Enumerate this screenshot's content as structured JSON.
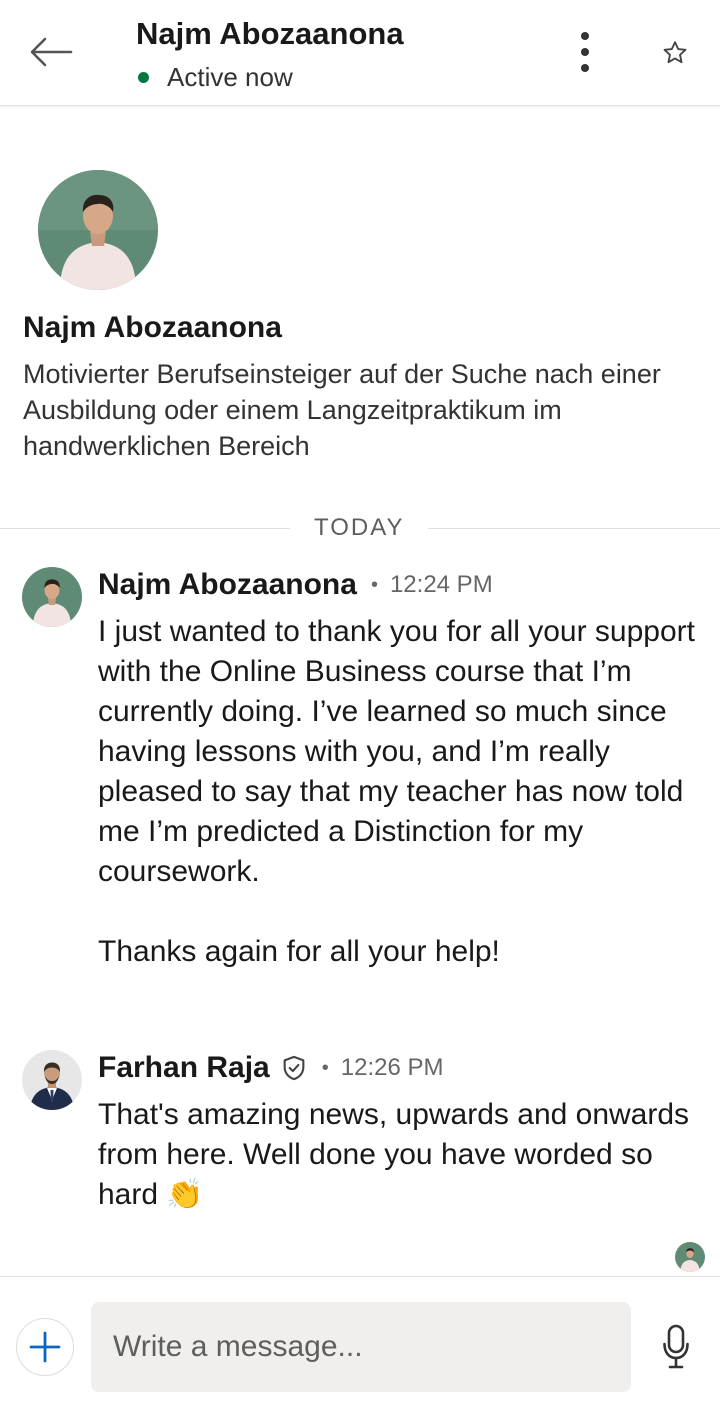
{
  "header": {
    "name": "Najm Abozaanona",
    "status": "Active now",
    "status_color": "#057642"
  },
  "profile": {
    "name": "Najm Abozaanona",
    "headline": "Motivierter Berufseinsteiger auf der Suche nach einer Ausbildung oder einem Langzeitpraktikum im handwerklichen Bereich"
  },
  "divider": {
    "label": "TODAY"
  },
  "messages": [
    {
      "sender": "Najm Abozaanona",
      "time": "12:24 PM",
      "text": "I just wanted to thank you for all your support with the Online Business course that I’m currently doing. I’ve learned so much since having lessons with you, and I’m really pleased to say that my teacher has now told me I’m predicted a Distinction for my coursework.\n\nThanks again for all your help!"
    },
    {
      "sender": "Farhan Raja",
      "time": "12:26 PM",
      "text": "That's amazing news, upwards and onwards from here. Well done you have worded so hard 👏"
    }
  ],
  "composer": {
    "placeholder": "Write a message..."
  },
  "icons": {
    "back": "arrow-left-icon",
    "more": "more-vertical-icon",
    "star": "star-icon",
    "verified": "verified-shield-icon",
    "plus": "plus-icon",
    "mic": "microphone-icon"
  },
  "colors": {
    "accent": "#0a66c2",
    "online": "#057642"
  }
}
